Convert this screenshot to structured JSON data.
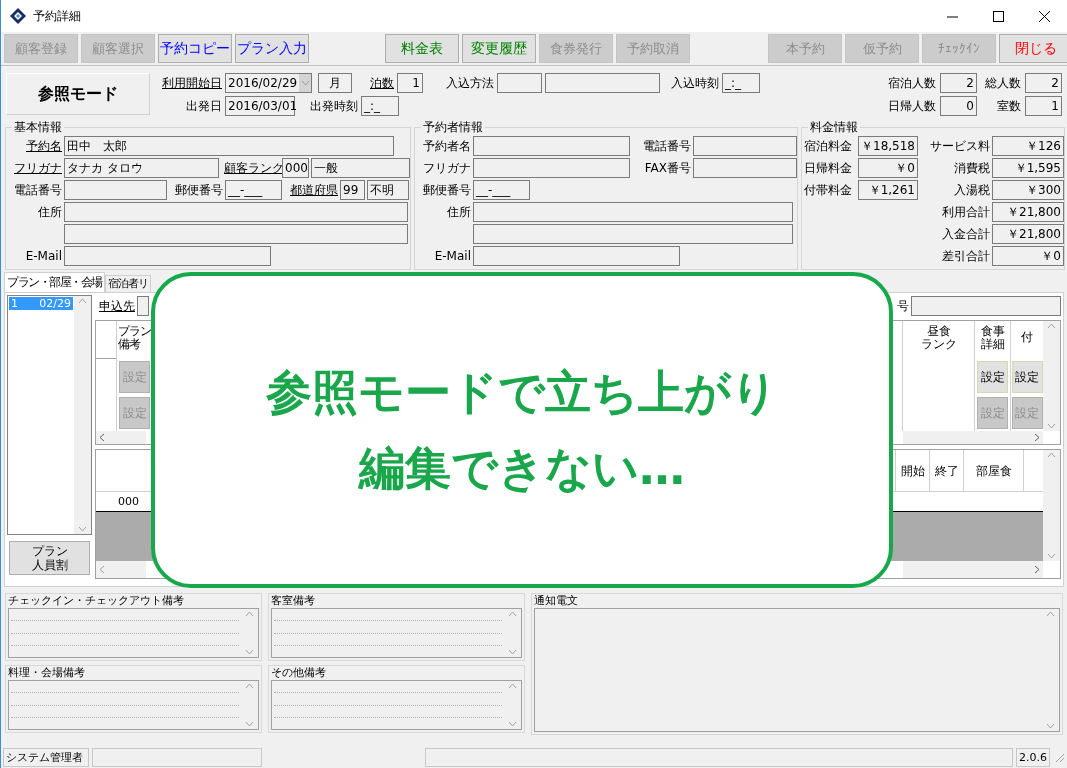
{
  "window": {
    "title": "予約詳細"
  },
  "toolbar": [
    {
      "buttons": [
        {
          "label": "顧客登録",
          "disabled": true,
          "color": "#8c8c8c"
        },
        {
          "label": "顧客選択",
          "disabled": true,
          "color": "#8c8c8c"
        },
        {
          "label": "予約コピー",
          "disabled": false,
          "color": "#0000ff"
        },
        {
          "label": "プラン入力",
          "disabled": false,
          "color": "#0000ff"
        }
      ]
    },
    {
      "buttons": [
        {
          "label": "料金表",
          "disabled": false,
          "color": "#008000"
        },
        {
          "label": "変更履歴",
          "disabled": false,
          "color": "#008000"
        },
        {
          "label": "食券発行",
          "disabled": true,
          "color": "#8c8c8c"
        },
        {
          "label": "予約取消",
          "disabled": true,
          "color": "#8c8c8c"
        }
      ]
    },
    {
      "buttons": [
        {
          "label": "本予約",
          "disabled": true,
          "color": "#8c8c8c"
        },
        {
          "label": "仮予約",
          "disabled": true,
          "color": "#8c8c8c"
        },
        {
          "label": "ﾁｪｯｸｲﾝ",
          "disabled": true,
          "color": "#8c8c8c"
        },
        {
          "label": "閉じる",
          "disabled": false,
          "color": "#ff0000"
        }
      ]
    }
  ],
  "mode": "参照モード",
  "reservation": {
    "start_date": {
      "label": "利用開始日",
      "link": true,
      "value": "2016/02/29"
    },
    "weekday": "月",
    "nights": {
      "label": "泊数",
      "link": true,
      "value": "1"
    },
    "arrival_method": {
      "label": "入込方法",
      "link": false
    },
    "arrival_time": {
      "label": "入込時刻",
      "link": false,
      "value": "_:_"
    },
    "departure_date": {
      "label": "出発日",
      "link": false,
      "value": "2016/03/01"
    },
    "departure_time": {
      "label": "出発時刻",
      "link": false,
      "value": "_:_"
    },
    "counts": [
      {
        "label": "宿泊人数",
        "value": "2"
      },
      {
        "label": "総人数",
        "value": "2"
      },
      {
        "label": "日帰人数",
        "value": "0"
      },
      {
        "label": "室数",
        "value": "1"
      }
    ]
  },
  "basic_info": {
    "title": "基本情報",
    "name": {
      "label": "予約名",
      "link": true,
      "value": "田中　太郎"
    },
    "kana": {
      "label": "フリガナ",
      "link": true,
      "value": "タナカ タロウ"
    },
    "customer_rank": {
      "label": "顧客ランク",
      "link": true,
      "code": "000",
      "value": "一般"
    },
    "phone": {
      "label": "電話番号",
      "link": false
    },
    "postal_code": {
      "label": "郵便番号",
      "link": false,
      "value": "__-___"
    },
    "prefecture": {
      "label": "都道府県",
      "link": true,
      "code": "99",
      "value": "不明"
    },
    "address": {
      "label": "住所",
      "link": false
    },
    "email": {
      "label": "E-Mail",
      "link": false
    }
  },
  "booker_info": {
    "title": "予約者情報",
    "name": {
      "label": "予約者名",
      "link": false
    },
    "phone": {
      "label": "電話番号",
      "link": false
    },
    "kana": {
      "label": "フリガナ",
      "link": false
    },
    "fax": {
      "label": "FAX番号",
      "link": false
    },
    "postal_code": {
      "label": "郵便番号",
      "link": false,
      "value": "__-___"
    },
    "address": {
      "label": "住所",
      "link": false
    },
    "email": {
      "label": "E-Mail",
      "link": false
    }
  },
  "charges": {
    "title": "料金情報",
    "left": [
      {
        "label": "宿泊料金",
        "value": "￥18,518"
      },
      {
        "label": "日帰料金",
        "value": "￥0"
      },
      {
        "label": "付帯料金",
        "value": "￥1,261"
      }
    ],
    "right": [
      {
        "label": "サービス料",
        "value": "￥126"
      },
      {
        "label": "消費税",
        "value": "￥1,595"
      },
      {
        "label": "入湯税",
        "value": "￥300"
      },
      {
        "label": "利用合計",
        "value": "￥21,800"
      },
      {
        "label": "入金合計",
        "value": "￥21,800"
      },
      {
        "label": "差引合計",
        "value": "￥0"
      }
    ]
  },
  "tabs": [
    {
      "label": "プラン・部屋・会場",
      "selected": true
    },
    {
      "label": "宿泊者リ",
      "selected": false
    }
  ],
  "dates": [
    {
      "no": "1",
      "date": "02/29",
      "selected": true
    }
  ],
  "plan_split_button": [
    "プラン",
    "人員割"
  ],
  "applicant": {
    "label": "申込先",
    "link": true
  },
  "number_label": "号",
  "plan_grid": {
    "left_column": [
      "プラン",
      "備考"
    ],
    "right_columns": [
      [
        "昼食",
        "ランク"
      ],
      [
        "食事",
        "詳細"
      ],
      [
        "付"
      ]
    ],
    "rows": [
      {
        "remark": {
          "label": "設定",
          "disabled": true
        },
        "meal_detail": {
          "label": "設定",
          "disabled": false
        },
        "extras": {
          "label": "設定",
          "disabled": false
        }
      },
      {
        "remark": {
          "label": "設定",
          "disabled": true
        },
        "meal_detail": {
          "label": "設定",
          "disabled": true
        },
        "extras": {
          "label": "設定",
          "disabled": true
        }
      }
    ]
  },
  "room_grid": {
    "columns": [
      "開始",
      "終了",
      "部屋食"
    ],
    "rows": [
      {
        "code": "000"
      }
    ]
  },
  "memos": [
    {
      "title": "チェックイン・チェックアウト備考"
    },
    {
      "title": "客室備考"
    },
    {
      "title": "通知電文"
    },
    {
      "title": "料理・会場備考"
    },
    {
      "title": "その他備考"
    }
  ],
  "status_bar": {
    "user": "システム管理者",
    "version": "2.0.6"
  },
  "callout": [
    "参照モードで立ち上がり",
    "編集できない…"
  ]
}
